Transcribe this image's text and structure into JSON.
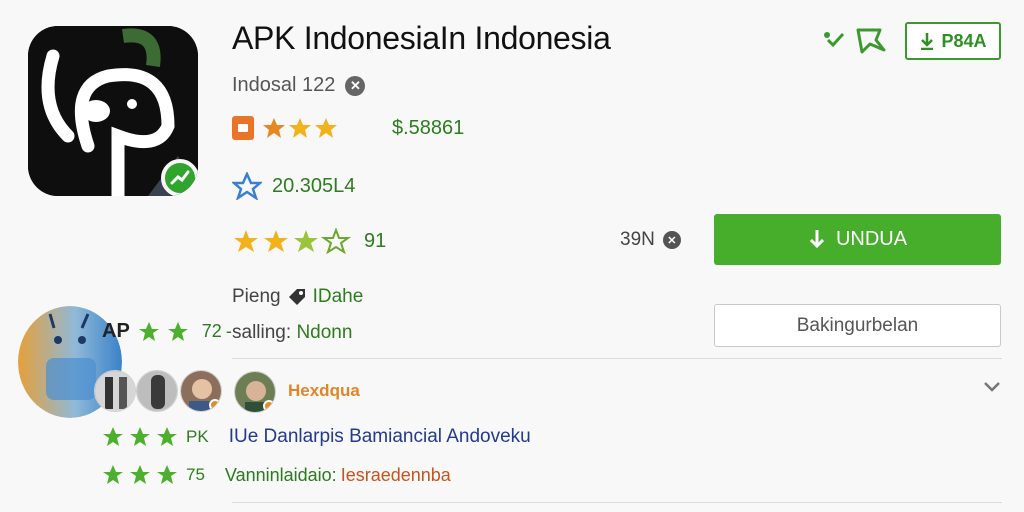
{
  "app": {
    "title": "APK IndonesiaIn Indonesia",
    "developer": "Indosal 122",
    "stat1": "$.58861",
    "stat2": "20.305L4",
    "rating": "91",
    "size": "39N",
    "install_label": "UNDUA",
    "secondary_label": "Bakingurbelan"
  },
  "header": {
    "badge_label": "P84A"
  },
  "info": {
    "line1_label": "Pieng",
    "line1_value": "IDahe",
    "line2_label": "salling:",
    "line2_value": "Ndonn"
  },
  "reviews": {
    "ap_label": "AP",
    "ap_count": "72",
    "reviewer_name": "Hexdqua",
    "row1_count": "PK",
    "row1_text": "IUe Danlarpis Bamiancial Andoveku",
    "row2_count": "75",
    "row2_text_a": "Vanninlaidaio:",
    "row2_text_b": "Iesraedennba"
  },
  "colors": {
    "accent_green": "#47ae2c",
    "star_gold": "#f2b21c",
    "link_blue": "#233a8f",
    "orange": "#e0862a"
  },
  "icons": [
    "check-icon",
    "certificate-icon",
    "download-icon",
    "close-icon",
    "star-icon",
    "star-outline-icon",
    "ticket-icon",
    "tag-icon",
    "chevron-down-icon",
    "verified-icon"
  ]
}
